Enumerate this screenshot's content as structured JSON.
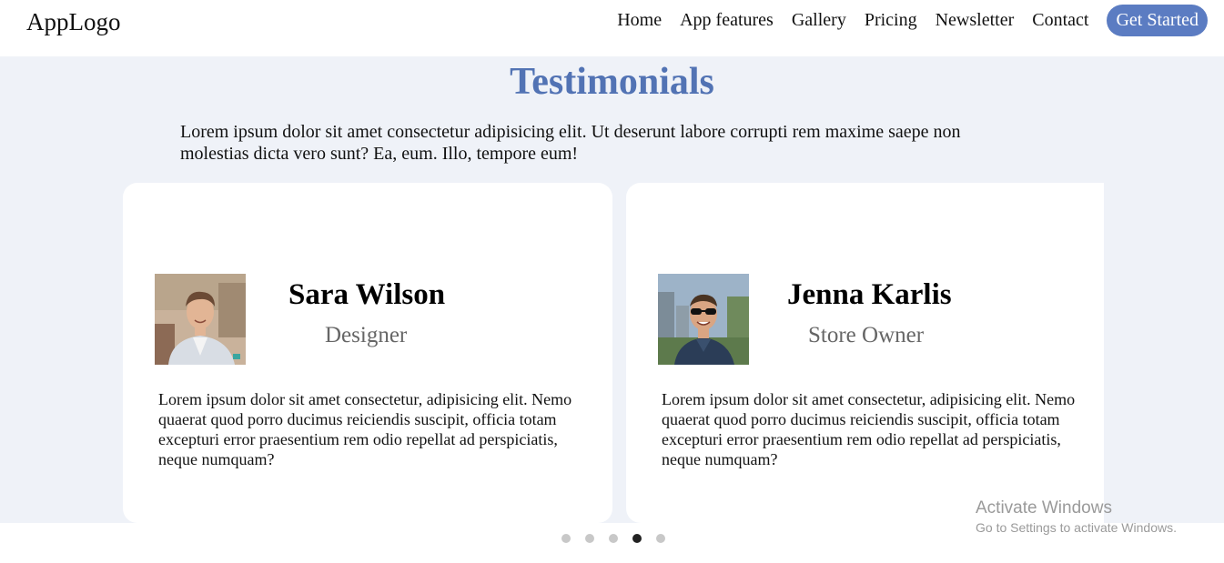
{
  "header": {
    "logo": "AppLogo",
    "nav": [
      "Home",
      "App features",
      "Gallery",
      "Pricing",
      "Newsletter",
      "Contact"
    ],
    "cta": "Get Started"
  },
  "section": {
    "title": "Testimonials",
    "intro": "Lorem ipsum dolor sit amet consectetur adipisicing elit. Ut deserunt labore corrupti rem maxime saepe non molestias dicta vero sunt? Ea, eum. Illo, tempore eum!"
  },
  "testimonials": [
    {
      "name": "Sara Wilson",
      "role": "Designer",
      "quote": "Lorem ipsum dolor sit amet consectetur, adipisicing elit. Nemo quaerat quod porro ducimus reiciendis suscipit, officia totam excepturi error praesentium rem odio repellat ad perspiciatis, neque numquam?"
    },
    {
      "name": "Jenna Karlis",
      "role": "Store Owner",
      "quote": "Lorem ipsum dolor sit amet consectetur, adipisicing elit. Nemo quaerat quod porro ducimus reiciendis suscipit, officia totam excepturi error praesentium rem odio repellat ad perspiciatis, neque numquam?"
    }
  ],
  "carousel": {
    "slide_count": 5,
    "active_index": 3
  },
  "watermark": {
    "title": "Activate Windows",
    "subtitle": "Go to Settings to activate Windows."
  },
  "colors": {
    "accent": "#5b7cc2",
    "title": "#5273b4",
    "section_bg": "#eff2f8"
  }
}
